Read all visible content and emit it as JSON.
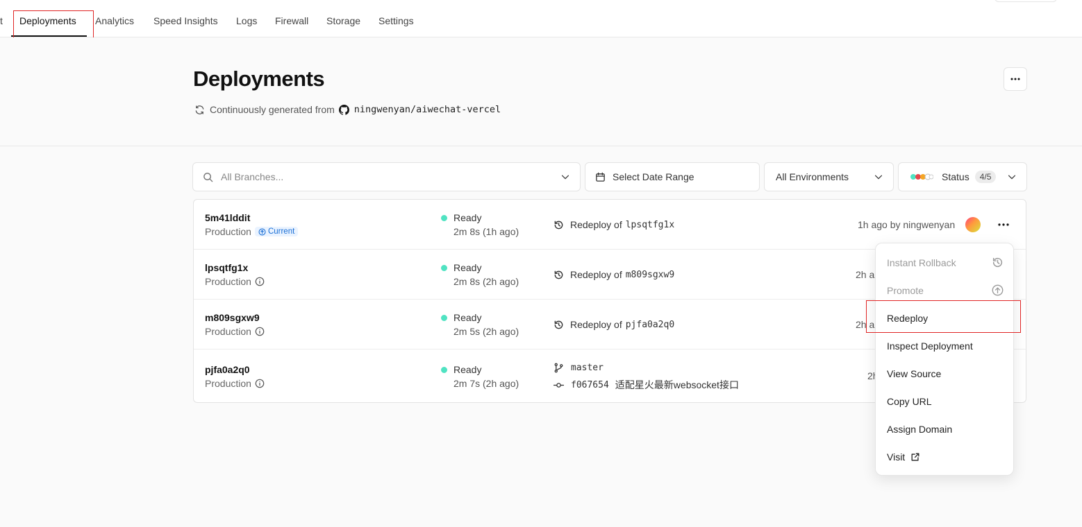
{
  "nav": {
    "tabs": [
      {
        "label": "t"
      },
      {
        "label": "Deployments"
      },
      {
        "label": "Analytics"
      },
      {
        "label": "Speed Insights"
      },
      {
        "label": "Logs"
      },
      {
        "label": "Firewall"
      },
      {
        "label": "Storage"
      },
      {
        "label": "Settings"
      }
    ],
    "active_tab": "Deployments"
  },
  "header": {
    "title": "Deployments",
    "subtitle": "Continuously generated from",
    "repo": "ningwenyan/aiwechat-vercel"
  },
  "filters": {
    "branches_placeholder": "All Branches...",
    "date_range": "Select Date Range",
    "environments": "All Environments",
    "status_label": "Status",
    "status_count": "4/5"
  },
  "deployments": [
    {
      "id": "5m41lddit",
      "environment": "Production",
      "badge": "Current",
      "status": "Ready",
      "duration": "2m 8s (1h ago)",
      "source_prefix": "Redeploy of",
      "source_ref": "lpsqtfg1x",
      "time_by": "1h ago by ningwenyan"
    },
    {
      "id": "lpsqtfg1x",
      "environment": "Production",
      "status": "Ready",
      "duration": "2m 8s (2h ago)",
      "source_prefix": "Redeploy of",
      "source_ref": "m809sgxw9",
      "time_by": "2h a"
    },
    {
      "id": "m809sgxw9",
      "environment": "Production",
      "status": "Ready",
      "duration": "2m 5s (2h ago)",
      "source_prefix": "Redeploy of",
      "source_ref": "pjfa0a2q0",
      "time_by": "2h a"
    },
    {
      "id": "pjfa0a2q0",
      "environment": "Production",
      "status": "Ready",
      "duration": "2m 7s (2h ago)",
      "branch": "master",
      "commit_hash": "f067654",
      "commit_message": "适配星火最新websocket接口",
      "time_by": "2h"
    }
  ],
  "context_menu": {
    "items": [
      {
        "label": "Instant Rollback",
        "disabled": true,
        "icon": "rollback-icon"
      },
      {
        "label": "Promote",
        "disabled": true,
        "icon": "arrow-up-circle-icon"
      },
      {
        "label": "Redeploy"
      },
      {
        "label": "Inspect Deployment"
      },
      {
        "label": "View Source"
      },
      {
        "label": "Copy URL"
      },
      {
        "label": "Assign Domain"
      },
      {
        "label": "Visit",
        "icon": "external-link-icon"
      }
    ]
  },
  "colors": {
    "ready_dot": "#50e3c2",
    "current_badge": "#1a6fd6",
    "highlight_box": "#e02424"
  }
}
